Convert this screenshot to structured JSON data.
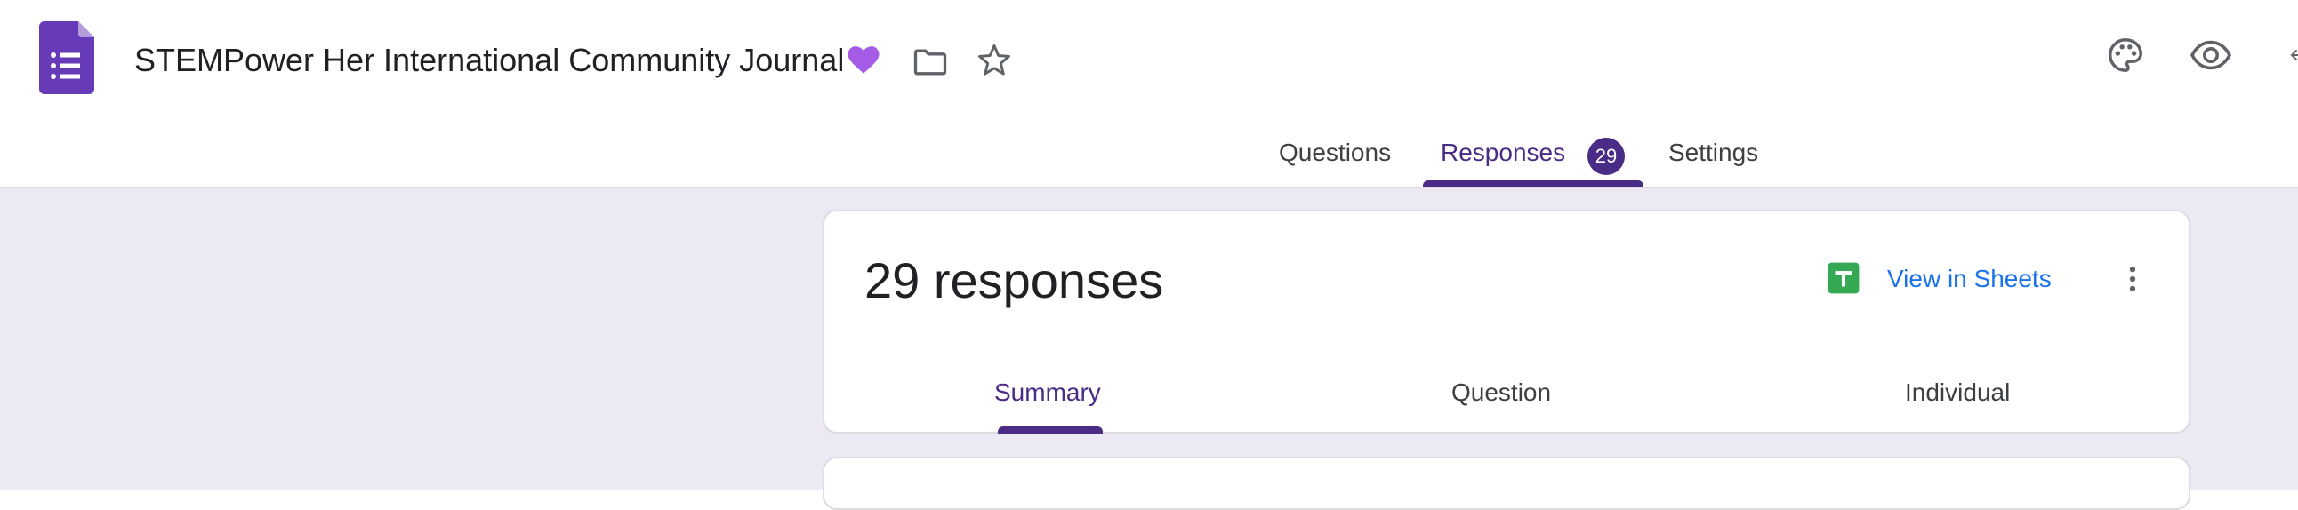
{
  "header": {
    "title": "STEMPower Her International Community Journal",
    "icons": {
      "app": "google-forms-icon",
      "heart": "purple-heart-emoji",
      "folder": "folder-icon",
      "star": "star-icon",
      "palette": "palette-icon",
      "preview": "eye-icon",
      "undo": "undo-icon"
    }
  },
  "tabs": {
    "questions": "Questions",
    "responses": "Responses",
    "responses_count": "29",
    "settings": "Settings"
  },
  "summary_card": {
    "count_label": "29 responses",
    "view_in_sheets": "View in Sheets",
    "subtabs": {
      "summary": "Summary",
      "question": "Question",
      "individual": "Individual"
    }
  },
  "colors": {
    "accent": "#4a2b86",
    "canvas_bg": "#ede9f4",
    "link": "#1a73e8",
    "sheets_green": "#34a853"
  }
}
